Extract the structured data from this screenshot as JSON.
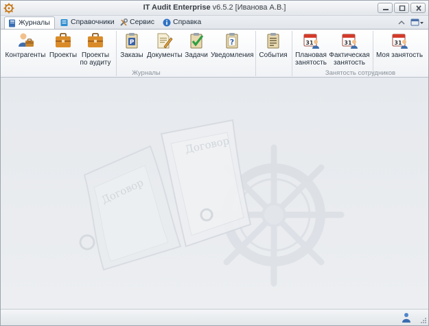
{
  "window": {
    "title_app": "IT Audit Enterprise",
    "title_rest": " v6.5.2 [Иванова А.В.]"
  },
  "tabs": [
    {
      "label": "Журналы",
      "icon": "journal-icon",
      "active": true
    },
    {
      "label": "Справочники",
      "icon": "reference-book-icon",
      "active": false
    },
    {
      "label": "Сервис",
      "icon": "tools-icon",
      "active": false
    },
    {
      "label": "Справка",
      "icon": "help-icon",
      "active": false
    }
  ],
  "ribbon": {
    "groups": [
      {
        "label": "Журналы"
      },
      {
        "label": "Занятость сотрудников"
      }
    ],
    "buttons": [
      {
        "label": "Контрагенты",
        "icon": "contractors-icon"
      },
      {
        "label": "Проекты",
        "icon": "briefcase-icon"
      },
      {
        "label1": "Проекты",
        "label2": "по аудиту",
        "icon": "briefcase-icon"
      },
      {
        "label": "Заказы",
        "icon": "orders-icon"
      },
      {
        "label": "Документы",
        "icon": "documents-icon"
      },
      {
        "label": "Задачи",
        "icon": "tasks-check-icon"
      },
      {
        "label": "Уведомления",
        "icon": "notifications-icon"
      },
      {
        "label": "События",
        "icon": "events-icon"
      },
      {
        "label1": "Плановая",
        "label2": "занятость",
        "icon": "calendar-user-icon"
      },
      {
        "label1": "Фактическая",
        "label2": "занятость",
        "icon": "calendar-user-icon"
      },
      {
        "label": "Моя занятость",
        "icon": "calendar-user-icon"
      }
    ]
  },
  "watermark": {
    "doc_text_1": "Договор",
    "doc_text_2": "Договор"
  },
  "colors": {
    "accent": "#3b6fb6",
    "briefcase": "#d98b2a",
    "calendar_red": "#d33b2b"
  }
}
